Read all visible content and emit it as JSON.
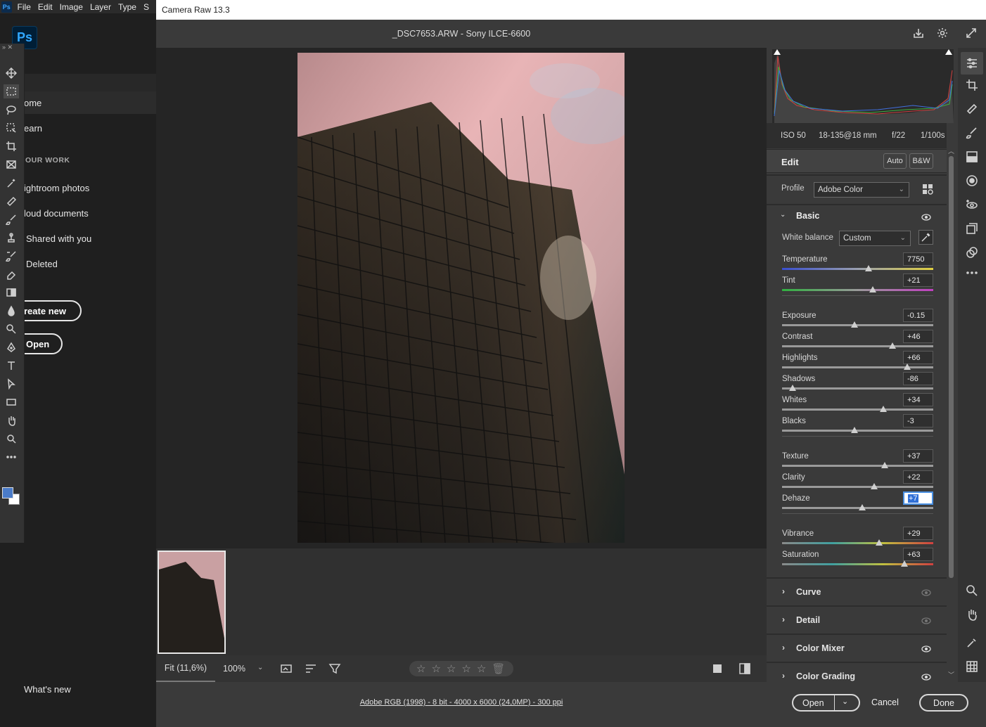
{
  "ps": {
    "logo": "Ps",
    "menu": [
      "File",
      "Edit",
      "Image",
      "Layer",
      "Type",
      "S"
    ],
    "big_logo": "Ps",
    "nav": {
      "home": "ome",
      "learn": "earn"
    },
    "your_work": "OUR WORK",
    "items": [
      "ightroom photos",
      "loud documents",
      "Shared with you",
      "Deleted"
    ],
    "create_new": "reate new",
    "open": "Open",
    "whats_new": "What's new",
    "tools": [
      "move-tool-icon",
      "marquee-tool-icon",
      "lasso-tool-icon",
      "object-selection-icon",
      "crop-tool-icon",
      "frame-tool-icon",
      "eyedropper-icon",
      "healing-brush-icon",
      "brush-tool-icon",
      "clone-stamp-icon",
      "history-brush-icon",
      "eraser-icon",
      "gradient-tool-icon",
      "blur-tool-icon",
      "dodge-tool-icon",
      "pen-tool-icon",
      "type-tool-icon",
      "path-selection-icon",
      "rectangle-tool-icon",
      "hand-tool-icon",
      "zoom-tool-icon",
      "more-tools-icon"
    ],
    "colors": {
      "foreground": "#4a7bc8",
      "background": "#ffffff"
    }
  },
  "cr": {
    "title": "Camera Raw 13.3",
    "filename": "_DSC7653.ARW  -  Sony ILCE-6600",
    "exif": {
      "iso": "ISO 50",
      "lens": "18-135@18 mm",
      "aperture": "f/22",
      "shutter": "1/100s"
    },
    "edit_label": "Edit",
    "auto": "Auto",
    "bw": "B&W",
    "profile_label": "Profile",
    "profile_value": "Adobe Color",
    "basic_label": "Basic",
    "wb_label": "White balance",
    "wb_value": "Custom",
    "sliders": [
      {
        "label": "Temperature",
        "value": "7750",
        "pos": 0.57,
        "kind": "temp"
      },
      {
        "label": "Tint",
        "value": "+21",
        "pos": 0.6,
        "kind": "tint"
      },
      {
        "label": "Exposure",
        "value": "-0.15",
        "pos": 0.48,
        "kind": "plain"
      },
      {
        "label": "Contrast",
        "value": "+46",
        "pos": 0.73,
        "kind": "plain"
      },
      {
        "label": "Highlights",
        "value": "+66",
        "pos": 0.83,
        "kind": "plain"
      },
      {
        "label": "Shadows",
        "value": "-86",
        "pos": 0.07,
        "kind": "plain"
      },
      {
        "label": "Whites",
        "value": "+34",
        "pos": 0.67,
        "kind": "plain"
      },
      {
        "label": "Blacks",
        "value": "-3",
        "pos": 0.48,
        "kind": "plain"
      },
      {
        "label": "Texture",
        "value": "+37",
        "pos": 0.68,
        "kind": "plain"
      },
      {
        "label": "Clarity",
        "value": "+22",
        "pos": 0.61,
        "kind": "plain"
      },
      {
        "label": "Dehaze",
        "value": "+7",
        "pos": 0.53,
        "kind": "plain"
      },
      {
        "label": "Vibrance",
        "value": "+29",
        "pos": 0.64,
        "kind": "color"
      },
      {
        "label": "Saturation",
        "value": "+63",
        "pos": 0.81,
        "kind": "color"
      }
    ],
    "sections": [
      "Curve",
      "Detail",
      "Color Mixer",
      "Color Grading"
    ],
    "zoom_fit": "Fit (11,6%)",
    "zoom_pct": "100%",
    "workflow": "Adobe RGB (1998) - 8 bit - 4000 x 6000 (24,0MP) - 300 ppi",
    "open_btn": "Open",
    "cancel_btn": "Cancel",
    "done_btn": "Done"
  }
}
